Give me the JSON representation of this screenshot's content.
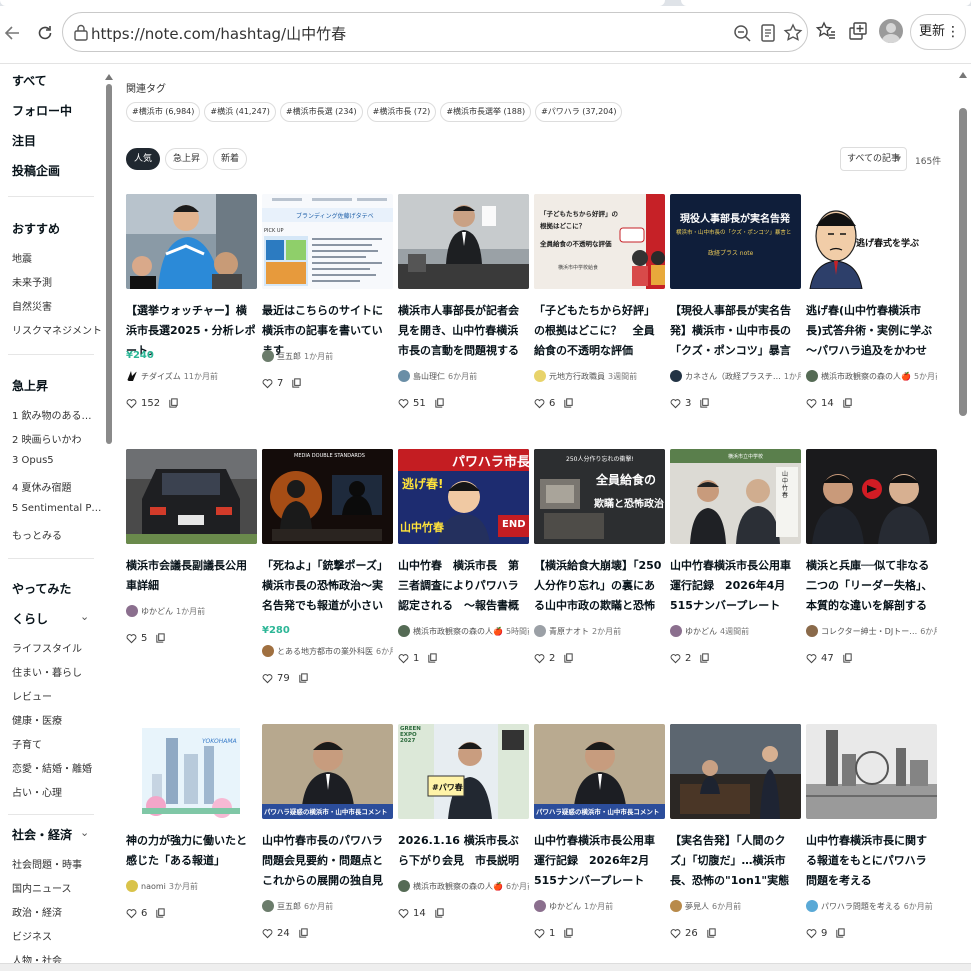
{
  "browser": {
    "url": "https://note.com/hashtag/山中竹春",
    "update_label": "更新",
    "more": "⋮"
  },
  "sidebar": {
    "main": [
      "すべて",
      "フォロー中",
      "注目",
      "投稿企画"
    ],
    "recommend_head": "おすすめ",
    "recommend": [
      "地震",
      "未来予測",
      "自然災害",
      "リスクマネジメント"
    ],
    "rising_head": "急上昇",
    "rising": [
      "1 飲み物のある…",
      "2 映画らいかわ",
      "3 Opus5",
      "4 夏休み宿題",
      "5 Sentimental P…"
    ],
    "rising_more": "もっとみる",
    "try_head": "やってみた",
    "life_head": "くらし",
    "life": [
      "ライフスタイル",
      "住まい・暮らし",
      "レビュー",
      "健康・医療",
      "子育て",
      "恋愛・結婚・離婚",
      "占い・心理"
    ],
    "society_head": "社会・経済",
    "society": [
      "社会問題・時事",
      "国内ニュース",
      "政治・経済",
      "ビジネス",
      "人物・社会"
    ],
    "chevron": "⌄"
  },
  "main": {
    "related_title": "関連タグ",
    "tags": [
      "#横浜市 (6,984)",
      "#横浜 (41,247)",
      "#横浜市長選 (234)",
      "#横浜市長 (72)",
      "#横浜市長選挙 (188)",
      "#パワハラ (37,204)"
    ],
    "filters": [
      "人気",
      "急上昇",
      "新着"
    ],
    "sort_label": "すべての記事",
    "sort_caret": "▼",
    "count": "165件"
  },
  "cards": [
    {
      "title": "【選挙ウォッチャー】横浜市長選2025・分析レポート。",
      "price": "¥240",
      "author": "チダイズム",
      "time": "11か月前",
      "likes": "152"
    },
    {
      "title": "最近はこちらのサイトに横浜市の記事を書いています",
      "price": "",
      "author": "亘五郎",
      "time": "1か月前",
      "likes": "7"
    },
    {
      "title": "横浜市人事部長が記者会見を開き、山中竹春横浜市長の言動を問題視する告発",
      "price": "",
      "author": "島山理仁",
      "time": "6か月前",
      "likes": "51"
    },
    {
      "title": "「子どもたちから好評」の根拠はどこに？　全員給食の不透明な評価",
      "price": "",
      "author": "元地方行政職員",
      "time": "3週間前",
      "likes": "6"
    },
    {
      "title": "【現役人事部長が実名告発】横浜市・山中市長の「クズ・ポンコツ」暴言と、言い訳に終始…",
      "price": "",
      "author": "カネさん（政経プラスチ…",
      "time": "1か月前",
      "likes": "3"
    },
    {
      "title": "逃げ春(山中竹春横浜市長)式答弁術・実例に学ぶ　～パワハラ追及をかわせ",
      "price": "",
      "author": "横浜市政観察の森の人🍎",
      "time": "5か月前",
      "likes": "14"
    },
    {
      "title": "横浜市会議長副議長公用車詳細",
      "price": "",
      "author": "ゆかどん",
      "time": "1か月前",
      "likes": "5"
    },
    {
      "title": "「死ねよ」「銃撃ポーズ」横浜市長の恐怖政治～実名告発でも報道が小さい理由～",
      "price": "¥280",
      "author": "とある地方都市の業外科医",
      "time": "6か月前",
      "likes": "79"
    },
    {
      "title": "山中竹春　横浜市長　第三者調査によりパワハラ認定される　～報告書概要～",
      "price": "",
      "author": "横浜市政観察の森の人🍎",
      "time": "5時間前",
      "likes": "1"
    },
    {
      "title": "【横浜給食大崩壊】「250人分作り忘れ」の裏にある山中市政の欺瞞と恐怖政治の正体",
      "price": "",
      "author": "青原ナオト",
      "time": "2か月前",
      "likes": "2"
    },
    {
      "title": "山中竹春横浜市長公用車運行記録　2026年4月　515ナンバープレート",
      "price": "",
      "author": "ゆかどん",
      "time": "4週間前",
      "likes": "2"
    },
    {
      "title": "横浜と兵庫──似て非なる二つの「リーダー失格」、本質的な違いを解剖する",
      "price": "",
      "author": "コレクター紳士・DJトー…",
      "time": "6か月前",
      "likes": "47"
    },
    {
      "title": "神の力が強力に働いたと感じた「ある報道」",
      "price": "",
      "author": "naomi",
      "time": "3か月前",
      "likes": "6"
    },
    {
      "title": "山中竹春市長のパワハラ問題会見要約・問題点とこれからの展開の独自見解",
      "price": "",
      "author": "亘五郎",
      "time": "6か月前",
      "likes": "24"
    },
    {
      "title": "2026.1.16 横浜市長ぶら下がり会見　市長説明",
      "price": "",
      "author": "横浜市政観察の森の人🍎",
      "time": "6か月前",
      "likes": "14"
    },
    {
      "title": "山中竹春横浜市長公用車運行記録　2026年2月　515ナンバープレート",
      "price": "",
      "author": "ゆかどん",
      "time": "1か月前",
      "likes": "1"
    },
    {
      "title": "【実名告発】「人間のクズ」「切腹だ」…横浜市長、恐怖の\"1on1\"実態",
      "price": "",
      "author": "夢見人",
      "time": "6か月前",
      "likes": "26"
    },
    {
      "title": "山中竹春横浜市長に関する報道をもとにパワハラ問題を考える",
      "price": "",
      "author": "パワハラ問題を考える",
      "time": "6か月前",
      "likes": "9"
    }
  ],
  "thumb_text": {
    "c2": "ブランディング佐藤げタテベ",
    "c2b": "PICK UP",
    "c4a": "「子どもたちから好評」の",
    "c4b": "根拠はどこに？",
    "c4c": "全員給食の不透明な評価",
    "c4d": "横浜市中学校給食",
    "c5a": "現役人事部長が実名告発",
    "c5b": "横浜市・山中市長の「クズ・ポンコツ」暴言と",
    "c5c": "政経プラス note",
    "c6": "逃げ春式を学ぶ",
    "c8": "MEDIA DOUBLE STANDARDS",
    "c9a": "パワハラ市長",
    "c9b": "逃げ春!",
    "c9c": "山中竹春",
    "c9d": "END",
    "c10a": "250人分作り忘れの衝撃!",
    "c10b": "全員給食の",
    "c10c": "欺瞞と恐怖政治",
    "c11a": "横浜市立中学校",
    "c11b": "山中竹春",
    "c13": "YOKOHAMA",
    "c14": "パワハラ疑惑の横浜市・山中市長コメント",
    "c15a": "GREEN EXPO 2027",
    "c15b": "#パワ春",
    "c16": "パワハラ疑惑の横浜市・山中市長コメント"
  },
  "colors": {
    "accent": "#2cb696",
    "active_chip": "#202830",
    "text": "#08131a"
  }
}
